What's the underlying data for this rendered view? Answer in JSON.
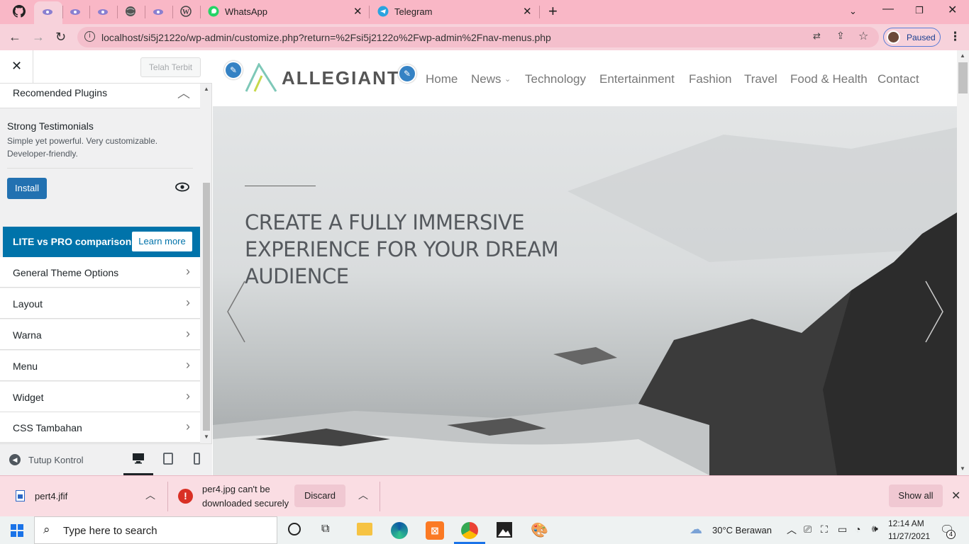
{
  "browser": {
    "tabs": [
      {
        "icon": "github-icon"
      },
      {
        "icon": "wordpress-local-icon"
      },
      {
        "icon": "wordpress-local-icon"
      },
      {
        "icon": "wordpress-local-icon"
      },
      {
        "icon": "globe-icon"
      },
      {
        "icon": "wordpress-local-icon"
      },
      {
        "icon": "wordpress-icon"
      }
    ],
    "whatsapp_tab": "WhatsApp",
    "telegram_tab": "Telegram",
    "url": "localhost/si5j2122o/wp-admin/customize.php?return=%2Fsi5j2122o%2Fwp-admin%2Fnav-menus.php",
    "profile_status": "Paused"
  },
  "customizer": {
    "publish_label": "Telah Terbit",
    "section_title": "Recomended Plugins",
    "plugin": {
      "name": "Strong Testimonials",
      "description": "Simple yet powerful. Very customizable. Developer-friendly.",
      "install_label": "Install"
    },
    "promo": {
      "label": "LITE vs PRO comparison",
      "button": "Learn more"
    },
    "sections": [
      {
        "label": "General Theme Options"
      },
      {
        "label": "Layout"
      },
      {
        "label": "Warna"
      },
      {
        "label": "Menu"
      },
      {
        "label": "Widget"
      },
      {
        "label": "CSS Tambahan"
      }
    ],
    "collapse_label": "Tutup Kontrol"
  },
  "site": {
    "logo_text": "ALLEGIANT",
    "menu": [
      "Home",
      "News",
      "Technology",
      "Entertainment",
      "Fashion",
      "Travel",
      "Food & Health",
      "Contact"
    ],
    "hero_line1": "CREATE A FULLY IMMERSIVE",
    "hero_line2": "EXPERIENCE FOR YOUR DREAM",
    "hero_line3": "AUDIENCE"
  },
  "downloads": {
    "item1": "pert4.jfif",
    "item2_line1": "per4.jpg can't be",
    "item2_line2": "downloaded securely",
    "discard": "Discard",
    "show_all": "Show all"
  },
  "taskbar": {
    "search_placeholder": "Type here to search",
    "weather": "30°C  Berawan",
    "time": "12:14 AM",
    "date": "11/27/2021",
    "notification_count": "4"
  },
  "colors": {
    "tab_bar": "#f9b7c6",
    "toolbar": "#f7d2db",
    "wp_blue": "#2271b1",
    "promo_bg": "#0073aa"
  }
}
